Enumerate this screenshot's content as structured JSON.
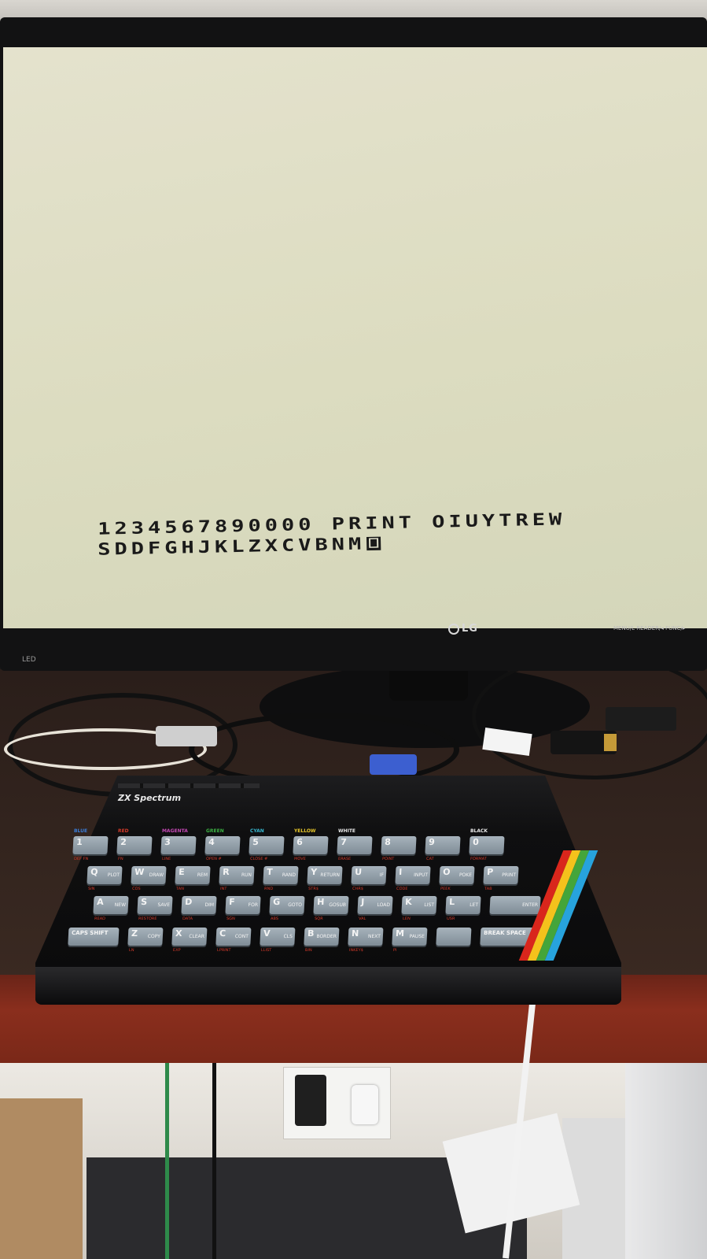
{
  "screen": {
    "line1": "1234567890000 PRINT OIUYTREW",
    "line2": "SDDFGHJKLZXCVBNM",
    "cursor": "L"
  },
  "monitor": {
    "brand": "LG",
    "led_label": "LED",
    "controls": "MENU/L  READER/◂  FUNC/▸"
  },
  "computer": {
    "badge": "ZX Spectrum",
    "rows": [
      [
        {
          "main": "1",
          "above": "BLUE",
          "above_color": "#3b7dd8",
          "below": "DEF FN"
        },
        {
          "main": "2",
          "above": "RED",
          "above_color": "#d23a2a",
          "below": "FN"
        },
        {
          "main": "3",
          "above": "MAGENTA",
          "above_color": "#c548b5",
          "below": "LINE"
        },
        {
          "main": "4",
          "above": "GREEN",
          "above_color": "#3cb043",
          "below": "OPEN #"
        },
        {
          "main": "5",
          "above": "CYAN",
          "above_color": "#38b7d0",
          "below": "CLOSE #"
        },
        {
          "main": "6",
          "above": "YELLOW",
          "above_color": "#e8c72a",
          "below": "MOVE"
        },
        {
          "main": "7",
          "above": "WHITE",
          "above_color": "#e8e8e8",
          "below": "ERASE"
        },
        {
          "main": "8",
          "above": "",
          "above_color": "#e8e8e8",
          "below": "POINT"
        },
        {
          "main": "9",
          "above": "",
          "above_color": "#e8e8e8",
          "below": "CAT"
        },
        {
          "main": "0",
          "above": "BLACK",
          "above_color": "#e8e8e8",
          "below": "FORMAT"
        }
      ],
      [
        {
          "main": "Q",
          "kw": "PLOT",
          "below": "SIN"
        },
        {
          "main": "W",
          "kw": "DRAW",
          "below": "COS"
        },
        {
          "main": "E",
          "kw": "REM",
          "below": "TAN"
        },
        {
          "main": "R",
          "kw": "RUN",
          "below": "INT"
        },
        {
          "main": "T",
          "kw": "RAND",
          "below": "RND"
        },
        {
          "main": "Y",
          "kw": "RETURN",
          "below": "STR$"
        },
        {
          "main": "U",
          "kw": "IF",
          "below": "CHR$"
        },
        {
          "main": "I",
          "kw": "INPUT",
          "below": "CODE"
        },
        {
          "main": "O",
          "kw": "POKE",
          "below": "PEEK"
        },
        {
          "main": "P",
          "kw": "PRINT",
          "below": "TAB"
        }
      ],
      [
        {
          "main": "A",
          "kw": "NEW",
          "below": "READ"
        },
        {
          "main": "S",
          "kw": "SAVE",
          "below": "RESTORE"
        },
        {
          "main": "D",
          "kw": "DIM",
          "below": "DATA"
        },
        {
          "main": "F",
          "kw": "FOR",
          "below": "SGN"
        },
        {
          "main": "G",
          "kw": "GOTO",
          "below": "ABS"
        },
        {
          "main": "H",
          "kw": "GOSUB",
          "below": "SQR"
        },
        {
          "main": "J",
          "kw": "LOAD",
          "below": "VAL"
        },
        {
          "main": "K",
          "kw": "LIST",
          "below": "LEN"
        },
        {
          "main": "L",
          "kw": "LET",
          "below": "USR"
        },
        {
          "main": "",
          "kw": "ENTER",
          "below": ""
        }
      ],
      [
        {
          "main": "CAPS SHIFT",
          "kw": "",
          "below": ""
        },
        {
          "main": "Z",
          "kw": "COPY",
          "below": "LN"
        },
        {
          "main": "X",
          "kw": "CLEAR",
          "below": "EXP"
        },
        {
          "main": "C",
          "kw": "CONT",
          "below": "LPRINT"
        },
        {
          "main": "V",
          "kw": "CLS",
          "below": "LLIST"
        },
        {
          "main": "B",
          "kw": "BORDER",
          "below": "BIN"
        },
        {
          "main": "N",
          "kw": "NEXT",
          "below": "INKEY$"
        },
        {
          "main": "M",
          "kw": "PAUSE",
          "below": "PI"
        },
        {
          "main": "",
          "kw": "",
          "below": ""
        },
        {
          "main": "BREAK SPACE",
          "kw": "",
          "below": ""
        }
      ]
    ],
    "rainbow": [
      "#d9261c",
      "#f4c21c",
      "#44a53a",
      "#27a3dd"
    ]
  }
}
